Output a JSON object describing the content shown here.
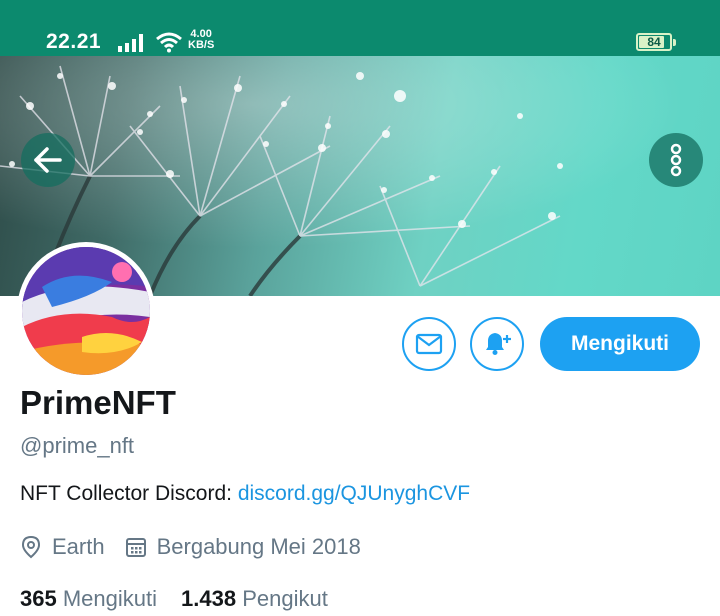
{
  "status_bar": {
    "time": "22.21",
    "speed_value": "4.00",
    "speed_unit": "KB/S",
    "battery": "84",
    "battery_level": 0.84,
    "color": "#0c8a6e"
  },
  "header": {
    "back_icon": "arrow-left-icon",
    "more_icon": "more-vertical-icon"
  },
  "profile": {
    "name": "PrimeNFT",
    "handle": "@prime_nft",
    "bio_text": "NFT Collector Discord: ",
    "bio_link": "discord.gg/QJUnyghCVF",
    "location": "Earth",
    "joined": "Bergabung Mei 2018",
    "following_count": "365",
    "following_label": "Mengikuti",
    "followers_count": "1.438",
    "followers_label": "Pengikut"
  },
  "actions": {
    "message_icon": "mail-icon",
    "notify_icon": "bell-plus-icon",
    "follow_label": "Mengikuti"
  },
  "colors": {
    "accent": "#1da1f2",
    "link": "#1b95e0",
    "text_primary": "#14171a",
    "text_secondary": "#657786"
  }
}
